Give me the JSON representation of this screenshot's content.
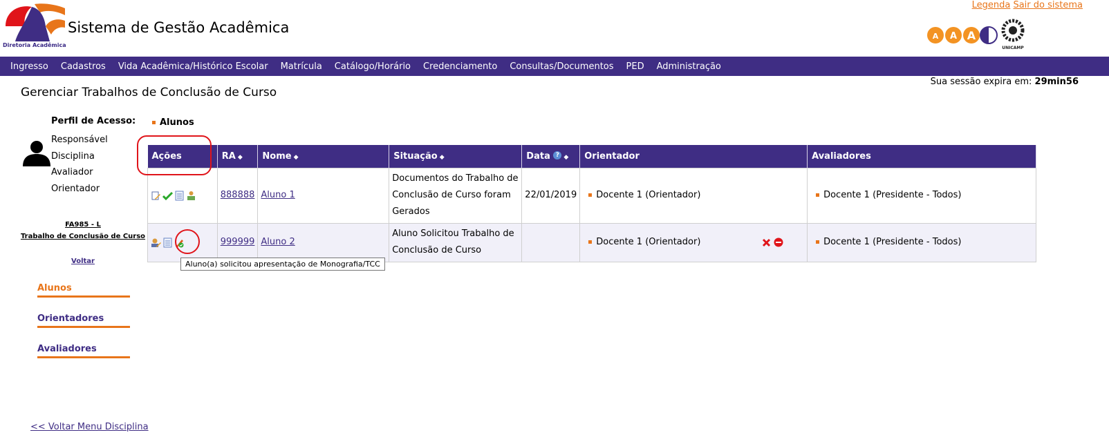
{
  "header": {
    "title": "Sistema de Gestão Acadêmica",
    "logo_text": "Diretoria Acadêmica",
    "links": {
      "legend": "Legenda",
      "logout": "Sair do sistema"
    },
    "unicamp_label": "UNICAMP",
    "access_buttons": [
      "A",
      "A",
      "A"
    ]
  },
  "nav": {
    "items": [
      "Ingresso",
      "Cadastros",
      "Vida Acadêmica/Histórico Escolar",
      "Matrícula",
      "Catálogo/Horário",
      "Credenciamento",
      "Consultas/Documentos",
      "PED",
      "Administração"
    ]
  },
  "session": {
    "label": "Sua sessão expira em:",
    "time": "29min56"
  },
  "page": {
    "title": "Gerenciar Trabalhos de Conclusão de Curso"
  },
  "profile": {
    "label": "Perfil de Acesso:",
    "roles": [
      "Responsável",
      "Disciplina",
      "Avaliador",
      "Orientador"
    ]
  },
  "course": {
    "code": "FA985 - L",
    "name": "Trabalho de Conclusão de Curso",
    "back": "Voltar"
  },
  "side_menu": {
    "items": [
      "Alunos",
      "Orientadores",
      "Avaliadores"
    ],
    "active": "Alunos"
  },
  "back_menu": "<< Voltar Menu Disciplina",
  "section": {
    "title": "Alunos"
  },
  "table": {
    "headers": {
      "actions": "Ações",
      "ra": "RA",
      "name": "Nome",
      "status": "Situação",
      "date": "Data",
      "advisor": "Orientador",
      "evaluators": "Avaliadores"
    },
    "rows": [
      {
        "ra": "888888",
        "name": "Aluno 1",
        "status": "Documentos do Trabalho de Conclusão de Curso foram Gerados",
        "date": "22/01/2019",
        "advisor": "Docente 1 (Orientador)",
        "evaluator": "Docente 1 (Presidente - Todos)"
      },
      {
        "ra": "999999",
        "name": "Aluno 2",
        "status": "Aluno Solicitou Trabalho de Conclusão de Curso",
        "date": "",
        "advisor": "Docente 1 (Orientador)",
        "evaluator": "Docente 1 (Presidente - Todos)"
      }
    ]
  },
  "tooltip": "Aluno(a) solicitou apresentação de Monografia/TCC",
  "colors": {
    "brand_purple": "#3f2d84",
    "accent_orange": "#e8751a",
    "highlight_red": "#e0141a"
  }
}
